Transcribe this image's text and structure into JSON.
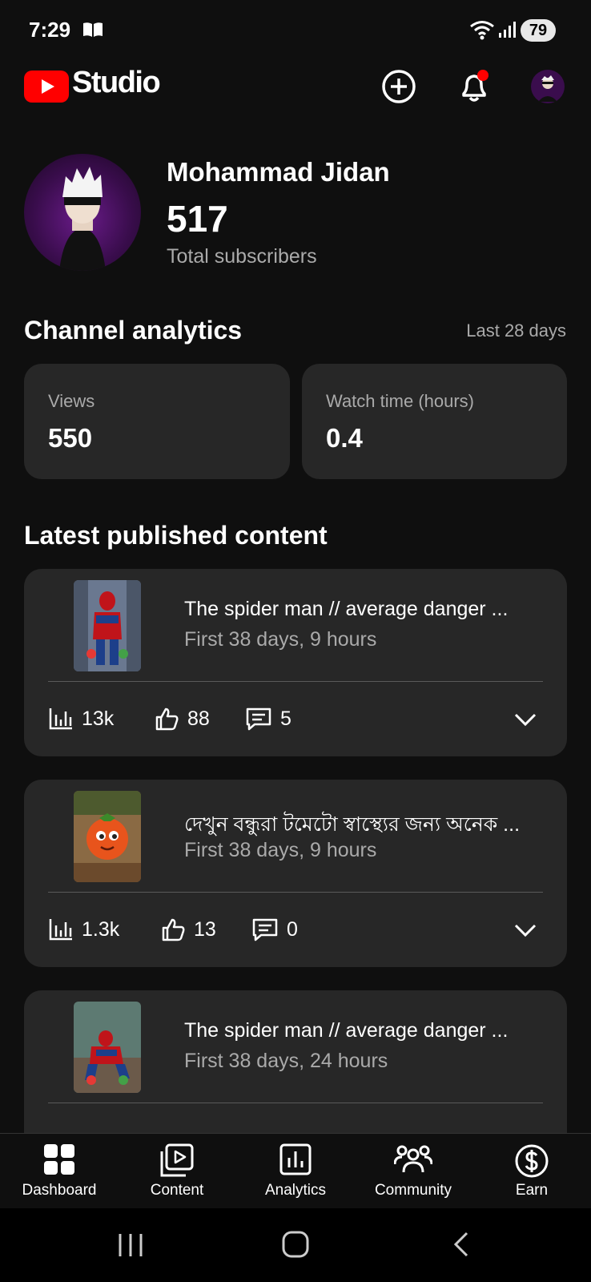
{
  "status_bar": {
    "time": "7:29",
    "battery": "79"
  },
  "app_bar": {
    "title": "Studio"
  },
  "profile": {
    "name": "Mohammad Jidan",
    "subscribers": "517",
    "subscribers_label": "Total subscribers"
  },
  "analytics": {
    "title": "Channel analytics",
    "period": "Last 28 days",
    "views_label": "Views",
    "views_value": "550",
    "watch_label": "Watch time (hours)",
    "watch_value": "0.4"
  },
  "latest": {
    "title": "Latest published content",
    "items": [
      {
        "title": "The spider man // average danger ...",
        "subtitle": "First 38 days, 9 hours",
        "views": "13k",
        "likes": "88",
        "comments": "5"
      },
      {
        "title": "দেখুন বন্ধুরা টমেটো স্বাস্থ্যের জন্য অনেক ...",
        "subtitle": "First 38 days, 9 hours",
        "views": "1.3k",
        "likes": "13",
        "comments": "0"
      },
      {
        "title": "The spider man // average danger ...",
        "subtitle": "First 38 days, 24 hours"
      }
    ]
  },
  "bottom_nav": {
    "dashboard": "Dashboard",
    "content": "Content",
    "analytics": "Analytics",
    "community": "Community",
    "earn": "Earn"
  },
  "colors": {
    "accent_red": "#ff0000",
    "card_bg": "#272727",
    "background": "#0f0f0f"
  }
}
